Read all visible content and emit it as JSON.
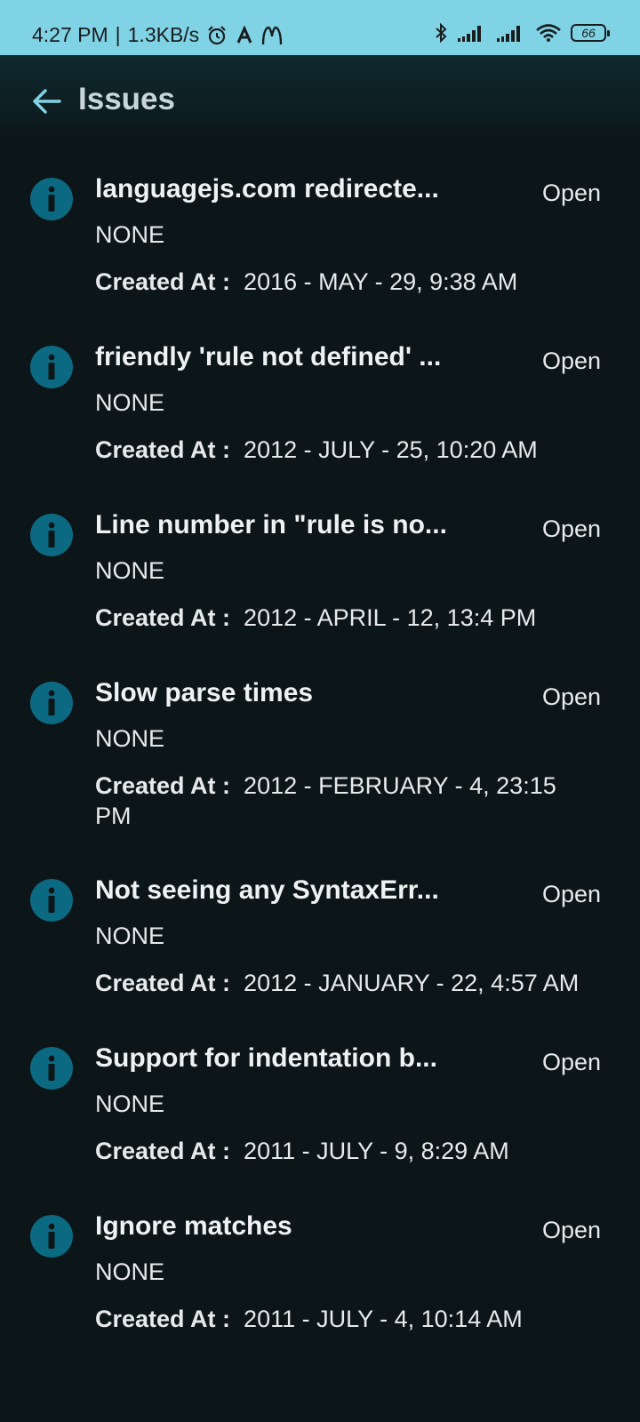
{
  "status_bar": {
    "time": "4:27 PM",
    "separator": "|",
    "speed": "1.3KB/s",
    "battery": "66",
    "icons": [
      "alarm-icon",
      "a-icon",
      "mcdonalds-icon",
      "bluetooth-icon",
      "signal-icon",
      "signal-icon",
      "wifi-icon",
      "battery-icon"
    ]
  },
  "header": {
    "title": "Issues",
    "back_icon": "arrow-left-icon"
  },
  "colors": {
    "status_bar_bg": "#7fd3e4",
    "background": "#0c1518",
    "info_icon": "#0b6a82",
    "back_arrow": "#7fd3e4"
  },
  "created_label": "Created At :",
  "issues": [
    {
      "title": "languagejs.com redirecte...",
      "status": "Open",
      "subtitle": "NONE",
      "created": "2016 - MAY - 29, 9:38 AM"
    },
    {
      "title": "friendly 'rule not defined' ...",
      "status": "Open",
      "subtitle": "NONE",
      "created": "2012 - JULY - 25, 10:20 AM"
    },
    {
      "title": "Line number in \"rule is no...",
      "status": "Open",
      "subtitle": "NONE",
      "created": "2012 - APRIL - 12, 13:4 PM"
    },
    {
      "title": "Slow parse times",
      "status": "Open",
      "subtitle": "NONE",
      "created": "2012 - FEBRUARY - 4, 23:15 PM"
    },
    {
      "title": "Not seeing any SyntaxErr...",
      "status": "Open",
      "subtitle": "NONE",
      "created": "2012 - JANUARY - 22, 4:57 AM"
    },
    {
      "title": "Support for indentation b...",
      "status": "Open",
      "subtitle": "NONE",
      "created": "2011 - JULY - 9, 8:29 AM"
    },
    {
      "title": "Ignore matches",
      "status": "Open",
      "subtitle": "NONE",
      "created": "2011 - JULY - 4, 10:14 AM"
    }
  ]
}
